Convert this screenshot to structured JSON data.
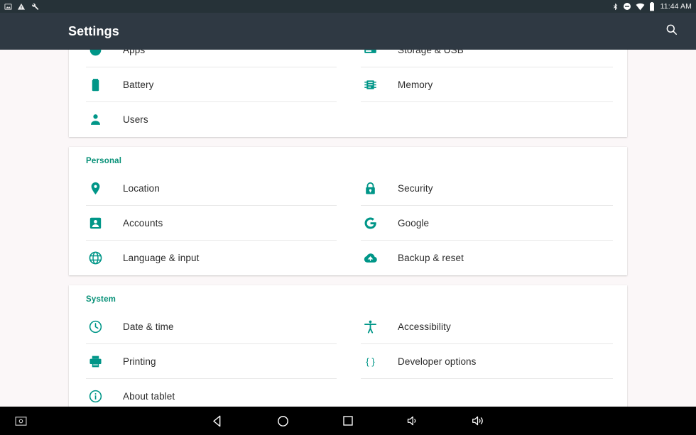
{
  "status_bar": {
    "left_icons": [
      {
        "name": "screenshot-icon"
      },
      {
        "name": "warning-triangle-icon"
      },
      {
        "name": "wrench-icon"
      }
    ],
    "right_icons": [
      {
        "name": "bluetooth-icon"
      },
      {
        "name": "do-not-disturb-icon"
      },
      {
        "name": "wifi-icon"
      },
      {
        "name": "battery-icon"
      }
    ],
    "time": "11:44 AM",
    "background_color": "#263238"
  },
  "app_bar": {
    "title": "Settings",
    "search_icon": "search-icon",
    "background_color": "#2f3943"
  },
  "theme": {
    "accent_color": "#009688",
    "section_header_color": "#089178",
    "page_background": "#fbf7f8",
    "card_background": "#ffffff",
    "divider_color": "#e8e8e8",
    "label_color": "#2b2b2b"
  },
  "sections": [
    {
      "id": "device-section",
      "header": null,
      "clipped_top": true,
      "left_items": [
        {
          "label": "Apps",
          "icon": "apps-icon",
          "clipped": true,
          "divider": true
        },
        {
          "label": "Battery",
          "icon": "battery-settings-icon",
          "divider": true
        },
        {
          "label": "Users",
          "icon": "users-icon",
          "divider": false
        }
      ],
      "right_items": [
        {
          "label": "Storage & USB",
          "icon": "storage-usb-icon",
          "clipped": true,
          "divider": true
        },
        {
          "label": "Memory",
          "icon": "memory-icon",
          "divider": true
        }
      ]
    },
    {
      "id": "personal-section",
      "header": "Personal",
      "left_items": [
        {
          "label": "Location",
          "icon": "location-pin-icon",
          "divider": true
        },
        {
          "label": "Accounts",
          "icon": "accounts-icon",
          "divider": true
        },
        {
          "label": "Language & input",
          "icon": "globe-icon",
          "divider": false
        }
      ],
      "right_items": [
        {
          "label": "Security",
          "icon": "lock-icon",
          "divider": true
        },
        {
          "label": "Google",
          "icon": "google-g-icon",
          "divider": true
        },
        {
          "label": "Backup & reset",
          "icon": "cloud-upload-icon",
          "divider": false
        }
      ]
    },
    {
      "id": "system-section",
      "header": "System",
      "left_items": [
        {
          "label": "Date & time",
          "icon": "clock-icon",
          "divider": true
        },
        {
          "label": "Printing",
          "icon": "printer-icon",
          "divider": true
        },
        {
          "label": "About tablet",
          "icon": "info-circle-icon",
          "divider": false
        }
      ],
      "right_items": [
        {
          "label": "Accessibility",
          "icon": "accessibility-icon",
          "divider": true
        },
        {
          "label": "Developer options",
          "icon": "braces-icon",
          "divider": true
        }
      ]
    }
  ],
  "nav_bar": {
    "background_color": "#000000",
    "left_button": {
      "name": "screenshot-button"
    },
    "buttons": [
      {
        "name": "back-button"
      },
      {
        "name": "home-button"
      },
      {
        "name": "recents-button"
      },
      {
        "name": "volume-down-button"
      },
      {
        "name": "volume-up-button"
      }
    ]
  }
}
